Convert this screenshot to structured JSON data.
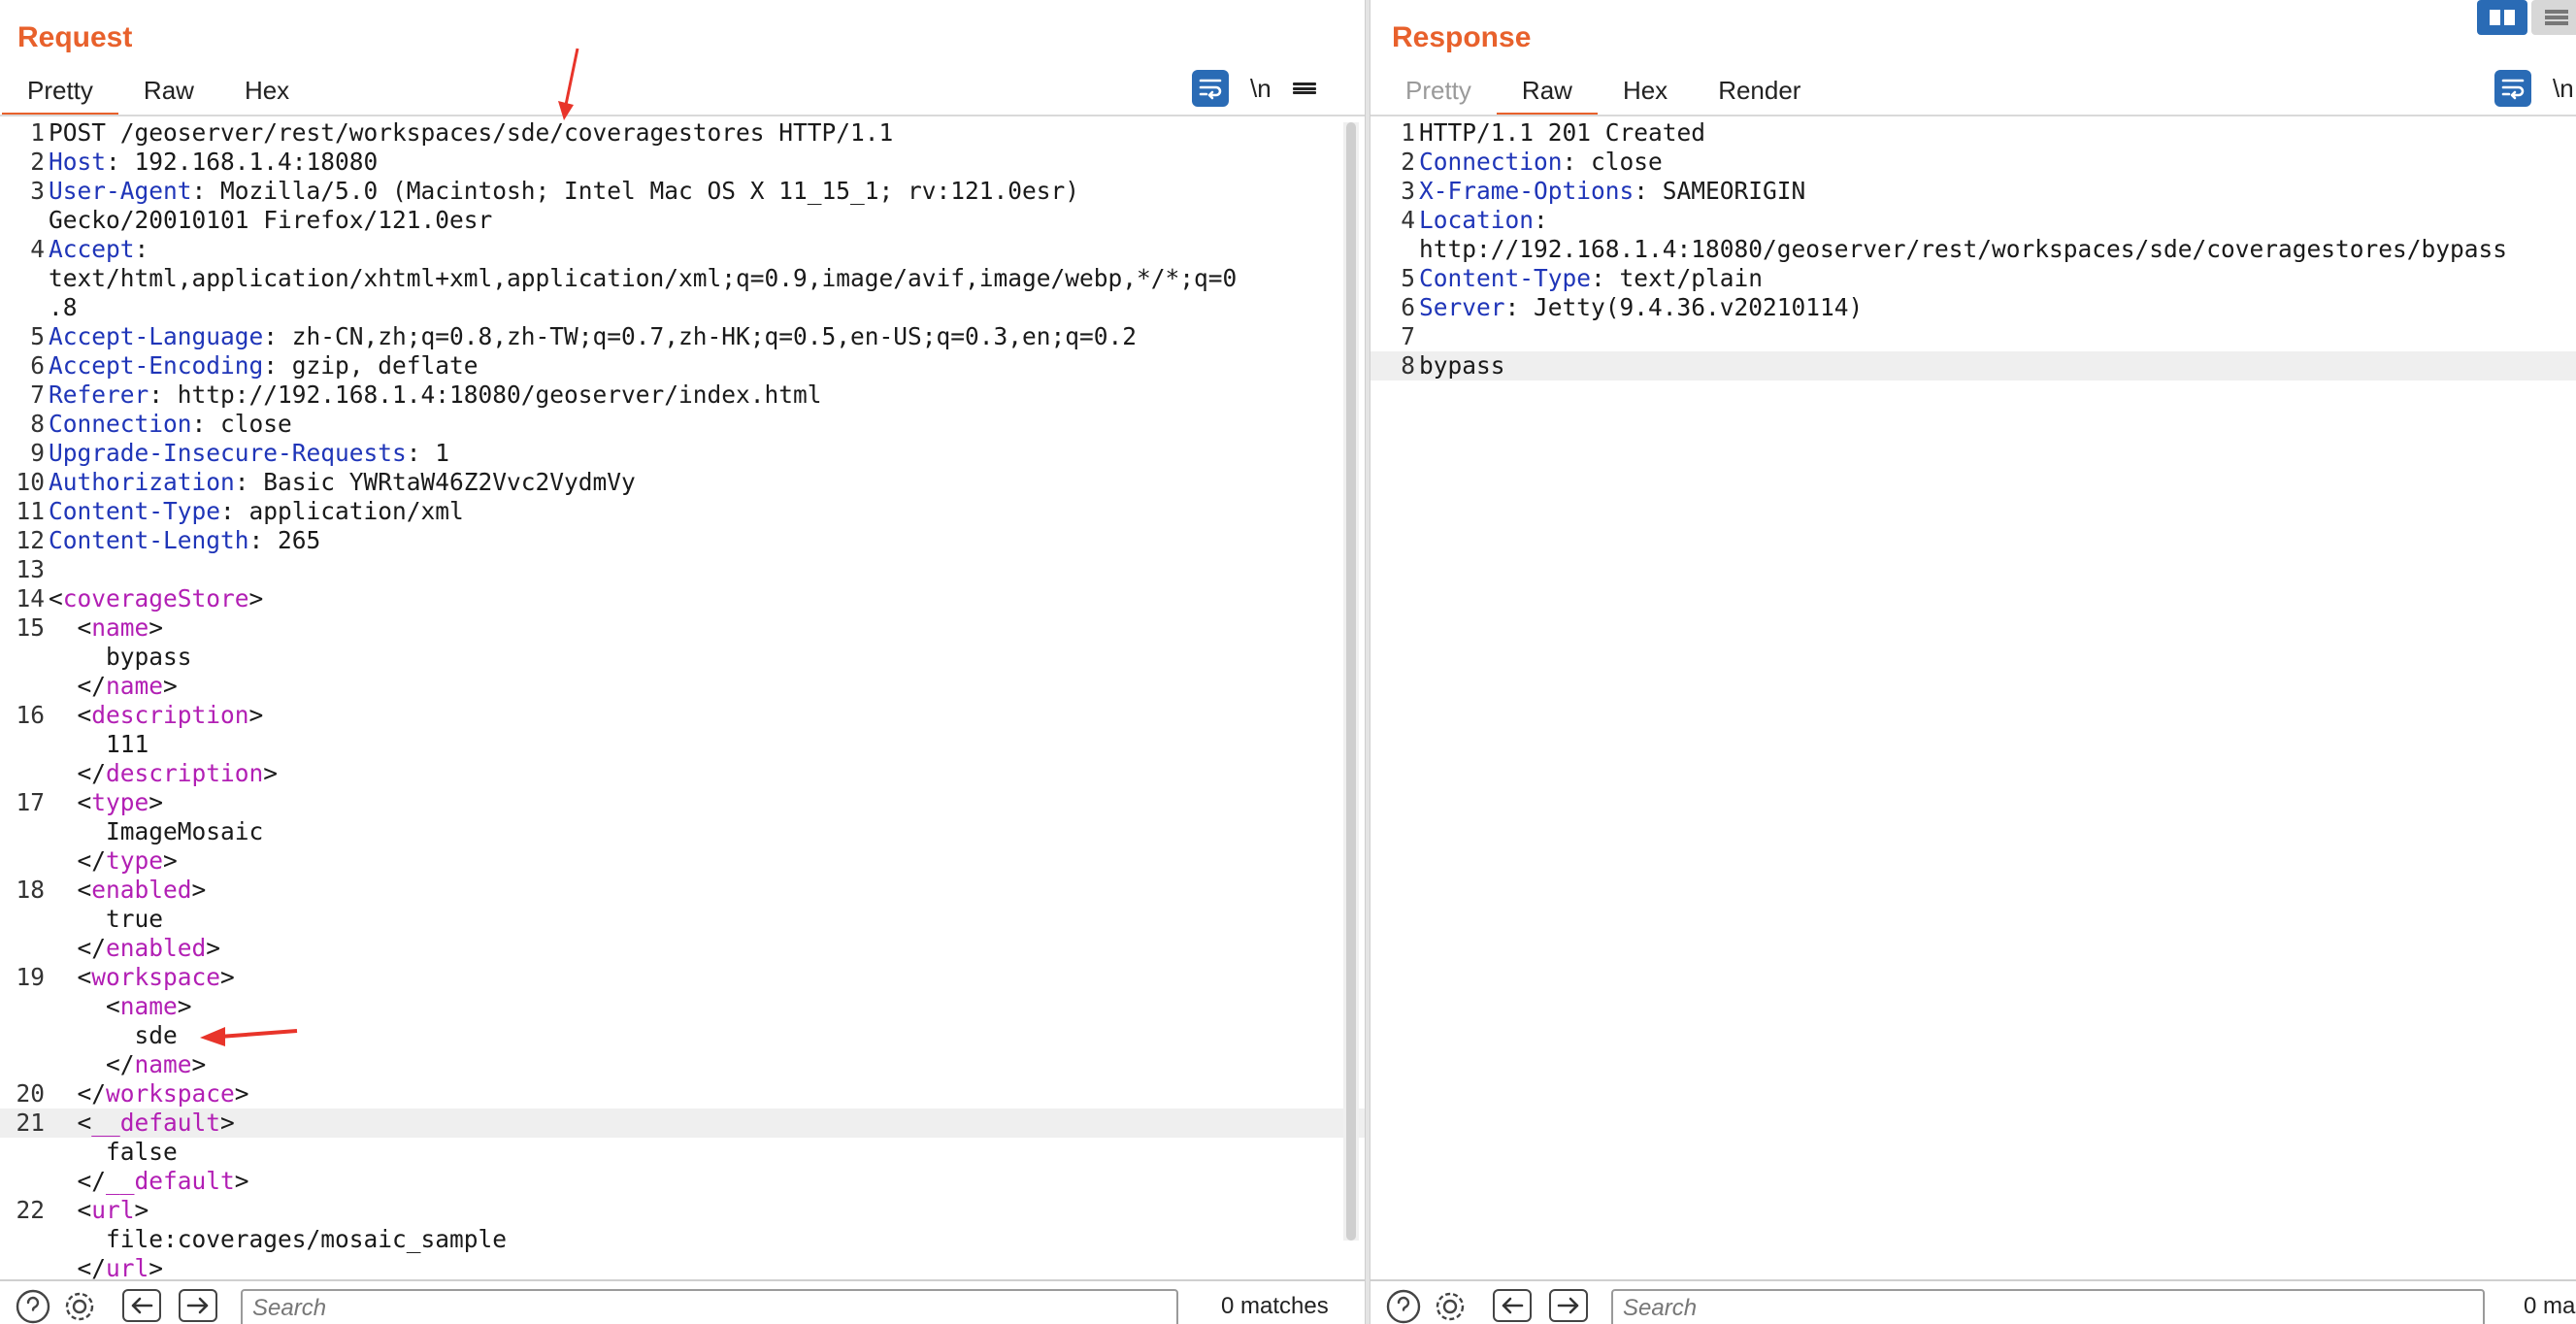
{
  "request": {
    "title": "Request",
    "tabs": [
      "Pretty",
      "Raw",
      "Hex"
    ],
    "active_tab": "Pretty",
    "newline_label": "\\n",
    "search_placeholder": "Search",
    "matches_text": "0 matches",
    "lines": [
      {
        "n": "1",
        "parts": [
          [
            "t",
            "POST /geoserver/rest/workspaces/sde/coveragestores HTTP/1.1"
          ]
        ]
      },
      {
        "n": "2",
        "parts": [
          [
            "k",
            "Host"
          ],
          [
            "t",
            ": 192.168.1.4:18080"
          ]
        ]
      },
      {
        "n": "3",
        "parts": [
          [
            "k",
            "User-Agent"
          ],
          [
            "t",
            ": Mozilla/5.0 (Macintosh; Intel Mac OS X 11_15_1; rv:121.0esr)"
          ]
        ],
        "cont": [
          "Gecko/20010101 Firefox/121.0esr"
        ]
      },
      {
        "n": "4",
        "parts": [
          [
            "k",
            "Accept"
          ],
          [
            "t",
            ":"
          ]
        ],
        "cont": [
          "text/html,application/xhtml+xml,application/xml;q=0.9,image/avif,image/webp,*/*;q=0",
          ".8"
        ]
      },
      {
        "n": "5",
        "parts": [
          [
            "k",
            "Accept-Language"
          ],
          [
            "t",
            ": zh-CN,zh;q=0.8,zh-TW;q=0.7,zh-HK;q=0.5,en-US;q=0.3,en;q=0.2"
          ]
        ]
      },
      {
        "n": "6",
        "parts": [
          [
            "k",
            "Accept-Encoding"
          ],
          [
            "t",
            ": gzip, deflate"
          ]
        ]
      },
      {
        "n": "7",
        "parts": [
          [
            "k",
            "Referer"
          ],
          [
            "t",
            ": http://192.168.1.4:18080/geoserver/index.html"
          ]
        ]
      },
      {
        "n": "8",
        "parts": [
          [
            "k",
            "Connection"
          ],
          [
            "t",
            ": close"
          ]
        ]
      },
      {
        "n": "9",
        "parts": [
          [
            "k",
            "Upgrade-Insecure-Requests"
          ],
          [
            "t",
            ": 1"
          ]
        ]
      },
      {
        "n": "10",
        "parts": [
          [
            "k",
            "Authorization"
          ],
          [
            "t",
            ": Basic YWRtaW46Z2Vvc2VydmVy"
          ]
        ]
      },
      {
        "n": "11",
        "parts": [
          [
            "k",
            "Content-Type"
          ],
          [
            "t",
            ": application/xml"
          ]
        ]
      },
      {
        "n": "12",
        "parts": [
          [
            "k",
            "Content-Length"
          ],
          [
            "t",
            ": 265"
          ]
        ]
      },
      {
        "n": "13",
        "parts": []
      },
      {
        "n": "14",
        "parts": [
          [
            "t",
            "<"
          ],
          [
            "g",
            "coverageStore"
          ],
          [
            "t",
            ">"
          ]
        ]
      },
      {
        "n": "15",
        "parts": [
          [
            "t",
            "  <"
          ],
          [
            "g",
            "name"
          ],
          [
            "t",
            ">"
          ]
        ]
      },
      {
        "n": "",
        "parts": [
          [
            "t",
            "    bypass"
          ]
        ]
      },
      {
        "n": "",
        "parts": [
          [
            "t",
            "  </"
          ],
          [
            "g",
            "name"
          ],
          [
            "t",
            ">"
          ]
        ]
      },
      {
        "n": "16",
        "parts": [
          [
            "t",
            "  <"
          ],
          [
            "g",
            "description"
          ],
          [
            "t",
            ">"
          ]
        ]
      },
      {
        "n": "",
        "parts": [
          [
            "t",
            "    111"
          ]
        ]
      },
      {
        "n": "",
        "parts": [
          [
            "t",
            "  </"
          ],
          [
            "g",
            "description"
          ],
          [
            "t",
            ">"
          ]
        ]
      },
      {
        "n": "17",
        "parts": [
          [
            "t",
            "  <"
          ],
          [
            "g",
            "type"
          ],
          [
            "t",
            ">"
          ]
        ]
      },
      {
        "n": "",
        "parts": [
          [
            "t",
            "    ImageMosaic"
          ]
        ]
      },
      {
        "n": "",
        "parts": [
          [
            "t",
            "  </"
          ],
          [
            "g",
            "type"
          ],
          [
            "t",
            ">"
          ]
        ]
      },
      {
        "n": "18",
        "parts": [
          [
            "t",
            "  <"
          ],
          [
            "g",
            "enabled"
          ],
          [
            "t",
            ">"
          ]
        ]
      },
      {
        "n": "",
        "parts": [
          [
            "t",
            "    true"
          ]
        ]
      },
      {
        "n": "",
        "parts": [
          [
            "t",
            "  </"
          ],
          [
            "g",
            "enabled"
          ],
          [
            "t",
            ">"
          ]
        ]
      },
      {
        "n": "19",
        "parts": [
          [
            "t",
            "  <"
          ],
          [
            "g",
            "workspace"
          ],
          [
            "t",
            ">"
          ]
        ]
      },
      {
        "n": "",
        "parts": [
          [
            "t",
            "    <"
          ],
          [
            "g",
            "name"
          ],
          [
            "t",
            ">"
          ]
        ]
      },
      {
        "n": "",
        "parts": [
          [
            "t",
            "      sde"
          ]
        ]
      },
      {
        "n": "",
        "parts": [
          [
            "t",
            "    </"
          ],
          [
            "g",
            "name"
          ],
          [
            "t",
            ">"
          ]
        ]
      },
      {
        "n": "20",
        "parts": [
          [
            "t",
            "  </"
          ],
          [
            "g",
            "workspace"
          ],
          [
            "t",
            ">"
          ]
        ]
      },
      {
        "n": "21",
        "parts": [
          [
            "t",
            "  <"
          ],
          [
            "g",
            "__default"
          ],
          [
            "t",
            ">"
          ]
        ],
        "hl": true
      },
      {
        "n": "",
        "parts": [
          [
            "t",
            "    false"
          ]
        ]
      },
      {
        "n": "",
        "parts": [
          [
            "t",
            "  </"
          ],
          [
            "g",
            "__default"
          ],
          [
            "t",
            ">"
          ]
        ]
      },
      {
        "n": "22",
        "parts": [
          [
            "t",
            "  <"
          ],
          [
            "g",
            "url"
          ],
          [
            "t",
            ">"
          ]
        ]
      },
      {
        "n": "",
        "parts": [
          [
            "t",
            "    file:coverages/mosaic_sample"
          ]
        ]
      },
      {
        "n": "",
        "parts": [
          [
            "t",
            "  </"
          ],
          [
            "g",
            "url"
          ],
          [
            "t",
            ">"
          ]
        ]
      }
    ]
  },
  "response": {
    "title": "Response",
    "tabs": [
      "Pretty",
      "Raw",
      "Hex",
      "Render"
    ],
    "active_tab": "Raw",
    "newline_label": "\\n",
    "search_placeholder": "Search",
    "matches_text": "0 ma",
    "lines": [
      {
        "n": "1",
        "parts": [
          [
            "t",
            "HTTP/1.1 201 Created"
          ]
        ]
      },
      {
        "n": "2",
        "parts": [
          [
            "k",
            "Connection"
          ],
          [
            "t",
            ": close"
          ]
        ]
      },
      {
        "n": "3",
        "parts": [
          [
            "k",
            "X-Frame-Options"
          ],
          [
            "t",
            ": SAMEORIGIN"
          ]
        ]
      },
      {
        "n": "4",
        "parts": [
          [
            "k",
            "Location"
          ],
          [
            "t",
            ":"
          ]
        ],
        "cont": [
          "http://192.168.1.4:18080/geoserver/rest/workspaces/sde/coveragestores/bypass"
        ]
      },
      {
        "n": "5",
        "parts": [
          [
            "k",
            "Content-Type"
          ],
          [
            "t",
            ": text/plain"
          ]
        ]
      },
      {
        "n": "6",
        "parts": [
          [
            "k",
            "Server"
          ],
          [
            "t",
            ": Jetty(9.4.36.v20210114)"
          ]
        ]
      },
      {
        "n": "7",
        "parts": []
      },
      {
        "n": "8",
        "parts": [
          [
            "t",
            "bypass"
          ]
        ],
        "hl": true
      }
    ]
  },
  "colors": {
    "accent": "#e8612c",
    "header_key": "#1f35b8",
    "xml_tag": "#b21fb4",
    "toolbar_blue": "#2a6bb5",
    "annotation_arrow": "#e8342a"
  }
}
